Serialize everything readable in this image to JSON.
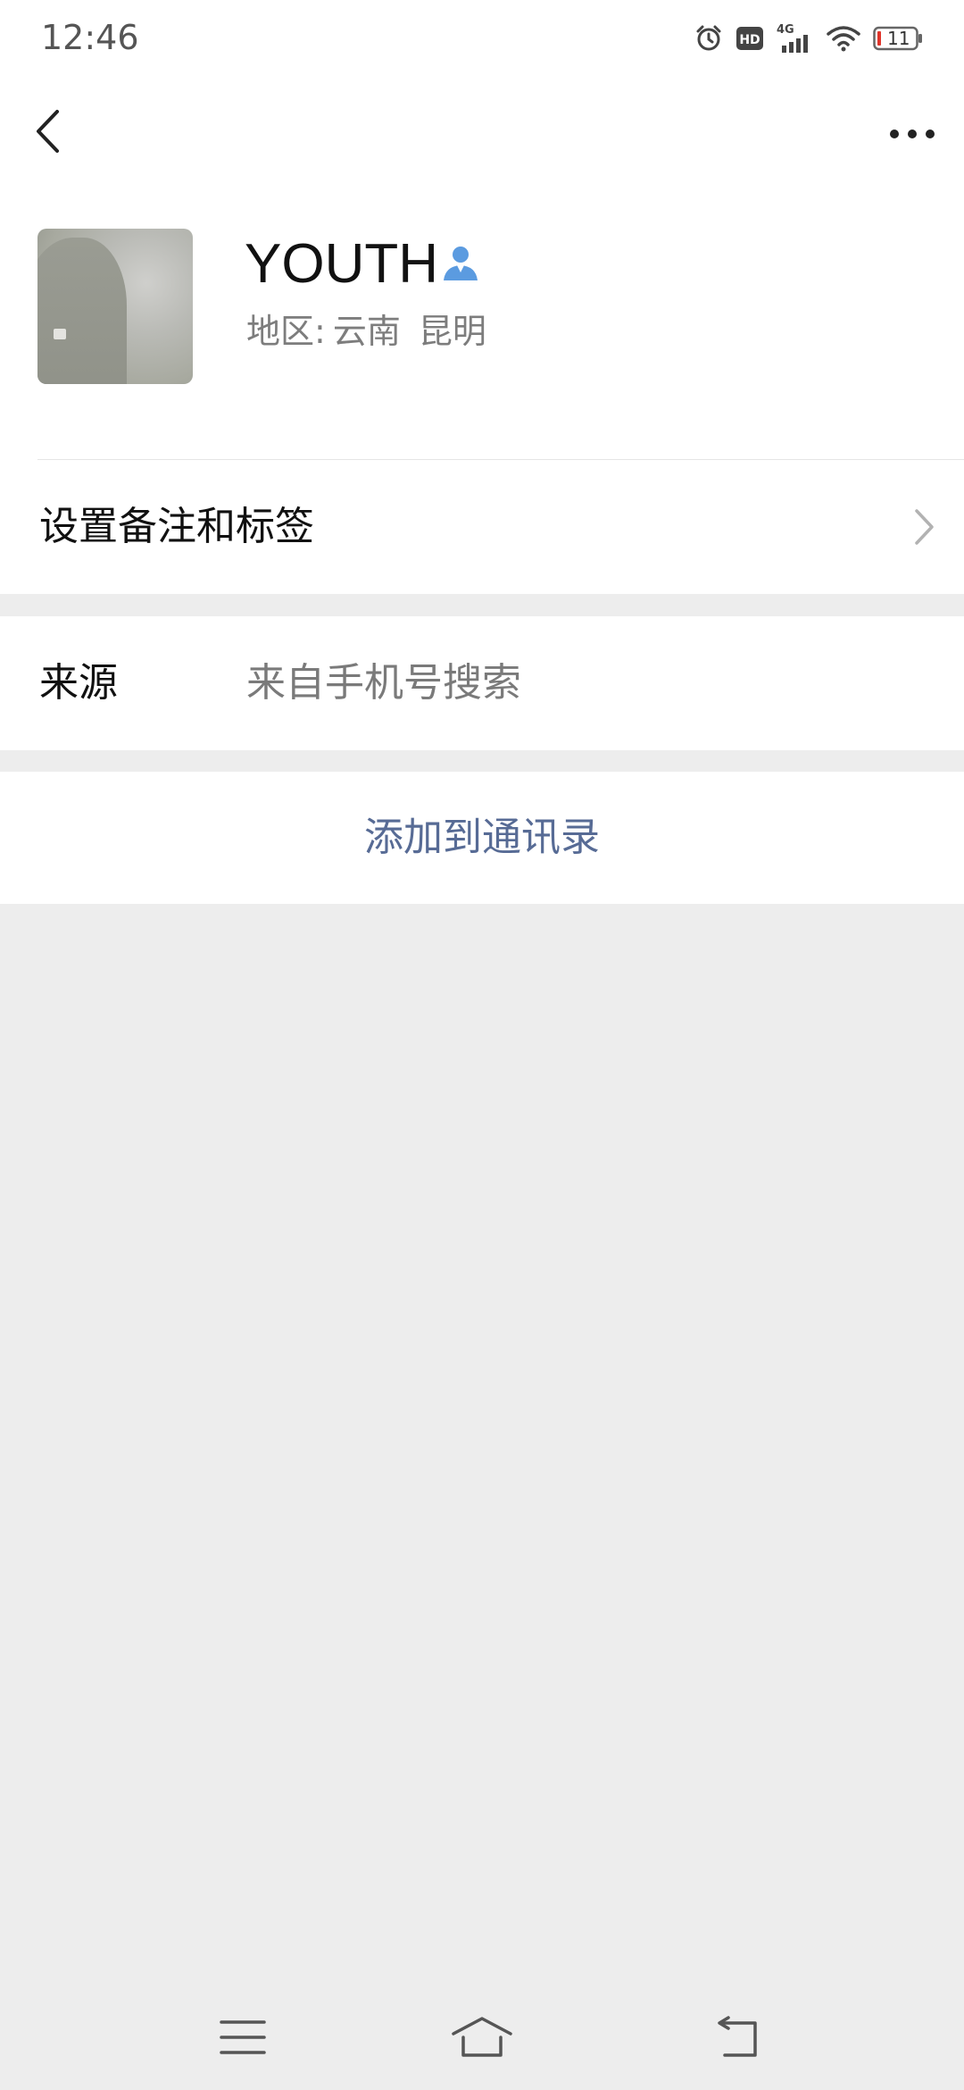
{
  "status_bar": {
    "time": "12:46",
    "network": "4G",
    "hd_badge": "HD",
    "battery_level": "11",
    "icons": [
      "alarm-icon",
      "hd-icon",
      "signal-4g-icon",
      "wifi-icon",
      "battery-icon"
    ]
  },
  "nav": {
    "back_icon": "chevron-left-icon",
    "more_icon": "more-dots-icon"
  },
  "profile": {
    "name": "YOUTH",
    "gender_icon": "male-user-icon",
    "region_prefix": "地区:",
    "region_province": "云南",
    "region_city": "昆明"
  },
  "rows": {
    "remark_label": "设置备注和标签",
    "source_label": "来源",
    "source_value": "来自手机号搜索"
  },
  "actions": {
    "add_to_contacts": "添加到通讯录"
  },
  "system_nav": {
    "icons": [
      "menu-icon",
      "home-icon",
      "back-return-icon"
    ]
  },
  "colors": {
    "accent_link": "#576b95",
    "gender_icon": "#5b9be0",
    "page_bg": "#ededed",
    "battery_low": "#e0352b"
  }
}
